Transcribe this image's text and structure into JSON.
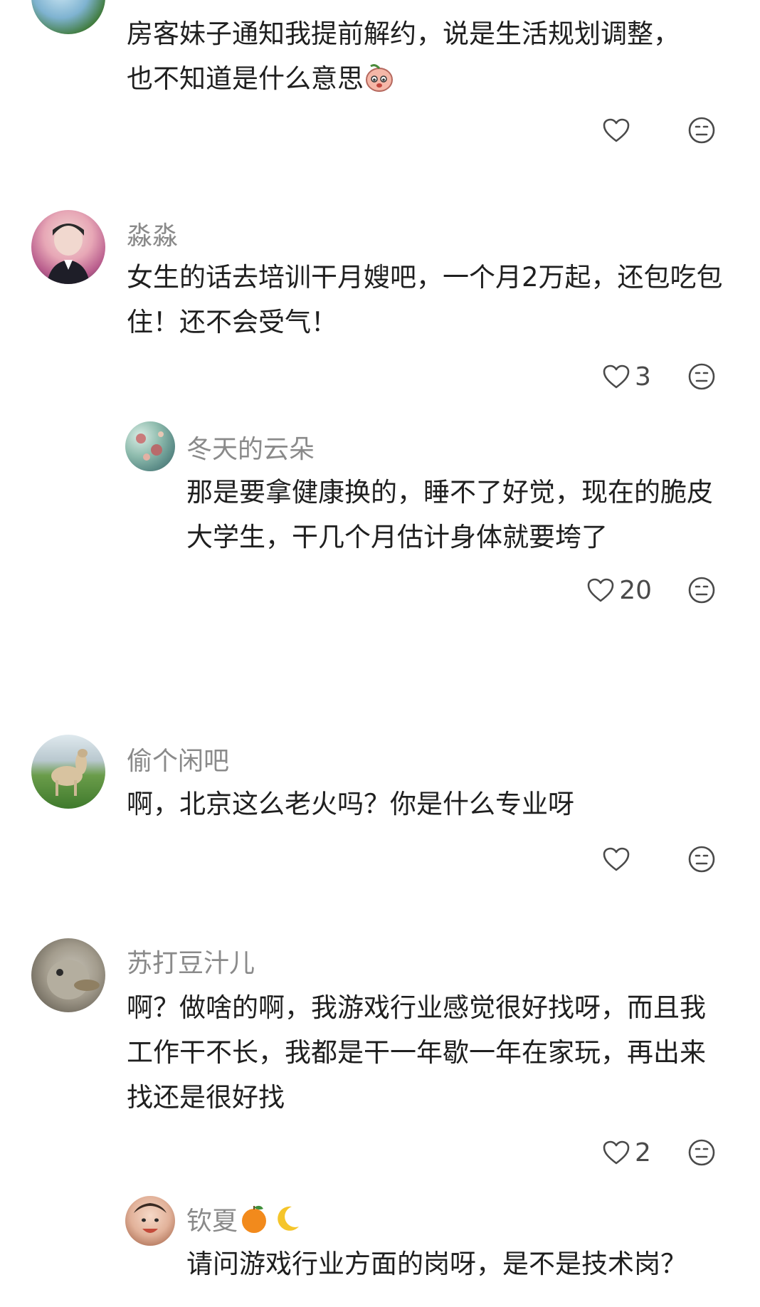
{
  "comments": [
    {
      "username": "",
      "text_1": "房客妹子通知我提前解约，说是生活规划调整，",
      "text_2": "也不知道是什么意思",
      "likes": "",
      "emoji": "peach-face"
    },
    {
      "username": "淼淼",
      "text": "女生的话去培训干月嫂吧，一个月2万起，还包吃包住！还不会受气！",
      "likes": "3"
    },
    {
      "username": "冬天的云朵",
      "text": "那是要拿健康换的，睡不了好觉，现在的脆皮大学生，干几个月估计身体就要垮了",
      "likes": "20"
    },
    {
      "username": "偷个闲吧",
      "text": "啊，北京这么老火吗？你是什么专业呀",
      "likes": ""
    },
    {
      "username": "苏打豆汁儿",
      "text": "啊？做啥的啊，我游戏行业感觉很好找呀，而且我工作干不长，我都是干一年歇一年在家玩，再出来找还是很好找",
      "likes": "2"
    },
    {
      "username": "钦夏",
      "username_emojis": [
        "orange",
        "crescent-moon"
      ],
      "text": "请问游戏行业方面的岗呀，是不是技术岗？",
      "likes": ""
    }
  ],
  "icons": {
    "like": "heart-outline-icon",
    "dislike": "neutral-face-icon"
  },
  "colors": {
    "text": "#1f1f1f",
    "username": "#8a8a8a",
    "icon": "#4a4a4a",
    "background": "#ffffff"
  }
}
